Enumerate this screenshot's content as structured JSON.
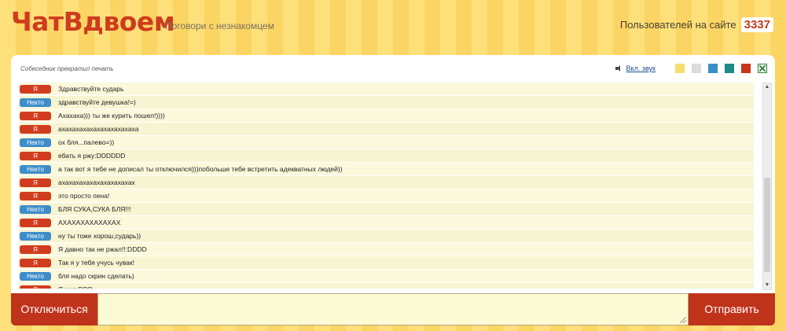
{
  "header": {
    "logo": "ЧатВдвоем",
    "tagline": "Поговори с незнакомцем",
    "online_label": "Пользователей на сайте",
    "online_count": "3337"
  },
  "chat": {
    "status": "Собеседник прекратил печать",
    "sound_label": "Вкл. звук",
    "theme_colors": [
      "#f7dc6f",
      "#dcdcdc",
      "#3a8fc8",
      "#1f8a88",
      "#c8361b"
    ],
    "badge_colors": {
      "me": "#d13c1f",
      "stranger": "#3d8dcb"
    },
    "messages": [
      {
        "sender": "Я",
        "role": "me",
        "text": "Здравствуйте сударь"
      },
      {
        "sender": "Некто",
        "role": "stranger",
        "text": "здравствуйте девушка!=)"
      },
      {
        "sender": "Я",
        "role": "me",
        "text": "Ахахаха))) ты же курить пошел!))))"
      },
      {
        "sender": "Я",
        "role": "me",
        "text": "ахахахахахахахахахахаха"
      },
      {
        "sender": "Некто",
        "role": "stranger",
        "text": "ох бля...палево=))"
      },
      {
        "sender": "Я",
        "role": "me",
        "text": "ебать я ржу:DDDDDD"
      },
      {
        "sender": "Некто",
        "role": "stranger",
        "text": "а так вот я тебе не дописал ты отключился)))побольше тебе встретить адекватных людей))"
      },
      {
        "sender": "Я",
        "role": "me",
        "text": "ахахахахахахахахахахах"
      },
      {
        "sender": "Я",
        "role": "me",
        "text": "это просто пена!"
      },
      {
        "sender": "Некто",
        "role": "stranger",
        "text": "БЛЯ СУКА,СУКА БЛЯ!!!"
      },
      {
        "sender": "Я",
        "role": "me",
        "text": "АХАХАХАХАХАХАХ"
      },
      {
        "sender": "Некто",
        "role": "stranger",
        "text": "ну ты тоже хорош,сударь))"
      },
      {
        "sender": "Я",
        "role": "me",
        "text": "Я давно так не ржал!!:DDDD"
      },
      {
        "sender": "Я",
        "role": "me",
        "text": "Так я у тебя учусь чувак!"
      },
      {
        "sender": "Некто",
        "role": "stranger",
        "text": "бля надо скрин сделать)"
      },
      {
        "sender": "Я",
        "role": "me",
        "text": "Я уже:DDD"
      }
    ]
  },
  "controls": {
    "disconnect_label": "Отключиться",
    "send_label": "Отправить",
    "input_value": ""
  }
}
